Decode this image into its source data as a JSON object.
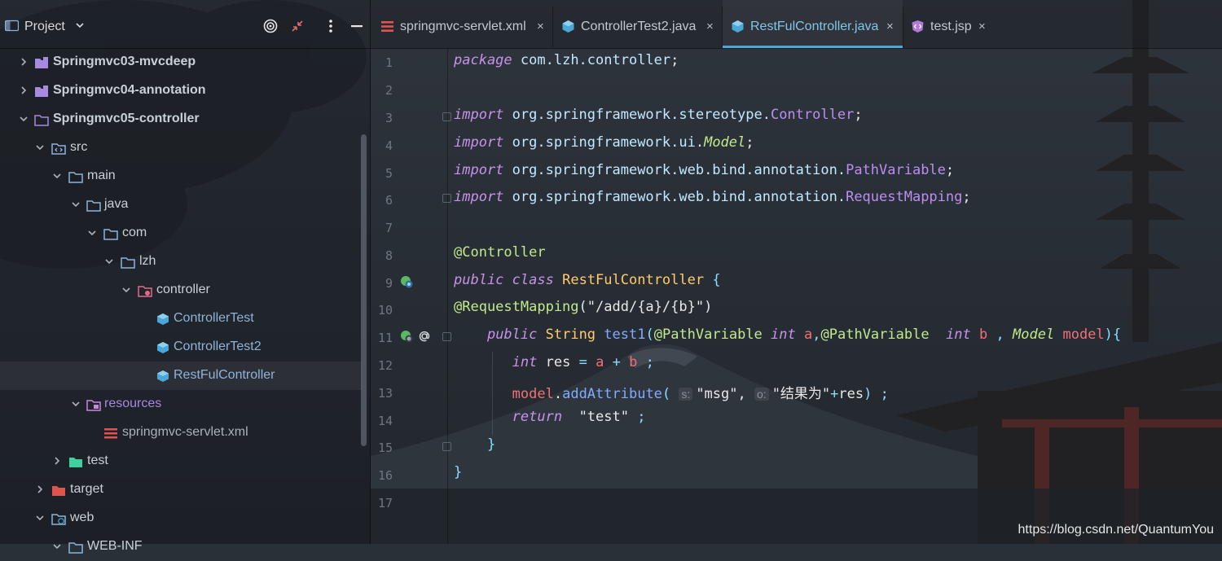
{
  "project_panel": {
    "title": "Project",
    "tree": [
      {
        "label": "Springmvc03-mvcdeep",
        "bold": true
      },
      {
        "label": "Springmvc04-annotation",
        "bold": true
      },
      {
        "label": "Springmvc05-controller",
        "bold": true
      },
      {
        "label": "src"
      },
      {
        "label": "main"
      },
      {
        "label": "java"
      },
      {
        "label": "com"
      },
      {
        "label": "lzh"
      },
      {
        "label": "controller"
      },
      {
        "label": "ControllerTest"
      },
      {
        "label": "ControllerTest2"
      },
      {
        "label": "RestFulController"
      },
      {
        "label": "resources"
      },
      {
        "label": "springmvc-servlet.xml"
      },
      {
        "label": "test"
      },
      {
        "label": "target"
      },
      {
        "label": "web"
      },
      {
        "label": "WEB-INF"
      }
    ]
  },
  "tabs": [
    {
      "label": "springmvc-servlet.xml",
      "icon": "xml-file-icon",
      "active": false
    },
    {
      "label": "ControllerTest2.java",
      "icon": "java-class-icon",
      "active": false
    },
    {
      "label": "RestFulController.java",
      "icon": "java-class-icon",
      "active": true
    },
    {
      "label": "test.jsp",
      "icon": "jsp-file-icon",
      "active": false
    }
  ],
  "tab_close": "×",
  "editor": {
    "line_numbers": [
      "1",
      "2",
      "3",
      "4",
      "5",
      "6",
      "7",
      "8",
      "9",
      "10",
      "11",
      "12",
      "13",
      "14",
      "15",
      "16",
      "17"
    ],
    "hints": {
      "s": "s:",
      "o": "o:"
    }
  },
  "colors": {
    "accent": "#4aa8d8",
    "keyword": "#c792ea",
    "annotation": "#c3e88d",
    "function": "#82aaff"
  },
  "watermark": "https://blog.csdn.net/QuantumYou"
}
